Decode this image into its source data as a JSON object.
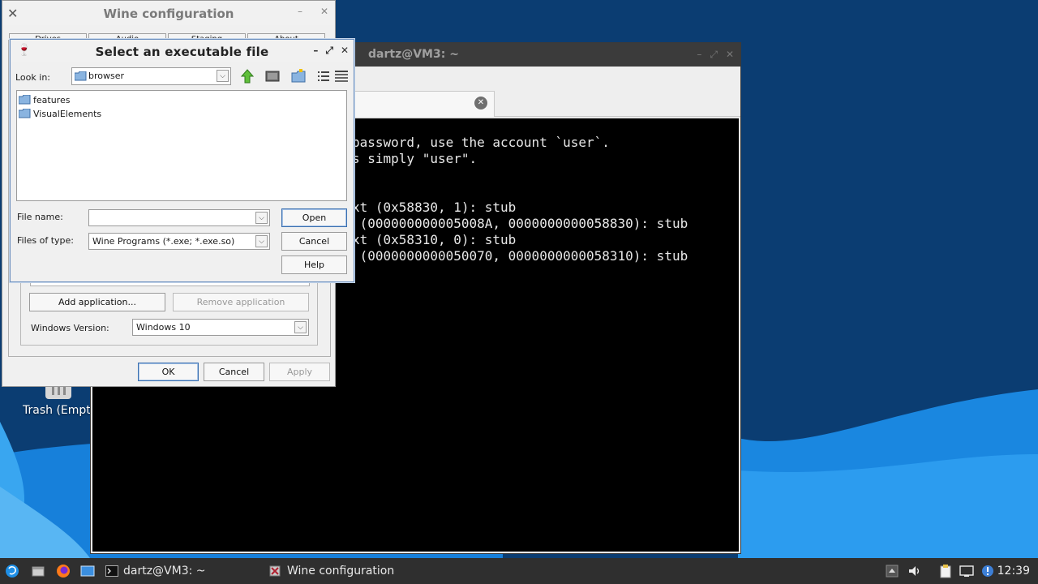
{
  "desktop": {
    "trash_label": "Trash (Empt"
  },
  "terminal": {
    "title": "dartz@VM3: ~",
    "lines": [
      "password, use the account `user`.",
      "s simply \"user\".",
      "",
      "",
      "xt (0x58830, 1): stub",
      " (000000000005008A, 0000000000058830): stub",
      "xt (0x58310, 0): stub",
      " (0000000000050070, 0000000000058310): stub"
    ]
  },
  "winecfg": {
    "title": "Wine configuration",
    "tabs": [
      "Drives",
      "Audio",
      "Staging",
      "About"
    ],
    "add_app": "Add application...",
    "remove_app": "Remove application",
    "version_label": "Windows Version:",
    "version_value": "Windows 10",
    "ok": "OK",
    "cancel": "Cancel",
    "apply": "Apply"
  },
  "file_dialog": {
    "title": "Select an executable file",
    "look_in_label": "Look in:",
    "look_in_value": "browser",
    "files": [
      "features",
      "VisualElements"
    ],
    "file_name_label": "File name:",
    "file_name_value": "",
    "files_type_label": "Files of type:",
    "files_type_value": "Wine Programs (*.exe; *.exe.so)",
    "open": "Open",
    "cancel": "Cancel",
    "help": "Help"
  },
  "taskbar": {
    "tasks": [
      "dartz@VM3: ~",
      "Wine configuration"
    ],
    "clock": "12:39"
  },
  "colors": {
    "desktop_dark": "#0a3a6e",
    "desktop_light": "#1e8fe6",
    "taskbar": "#2f2f2f",
    "terminal_bg": "#000000"
  }
}
